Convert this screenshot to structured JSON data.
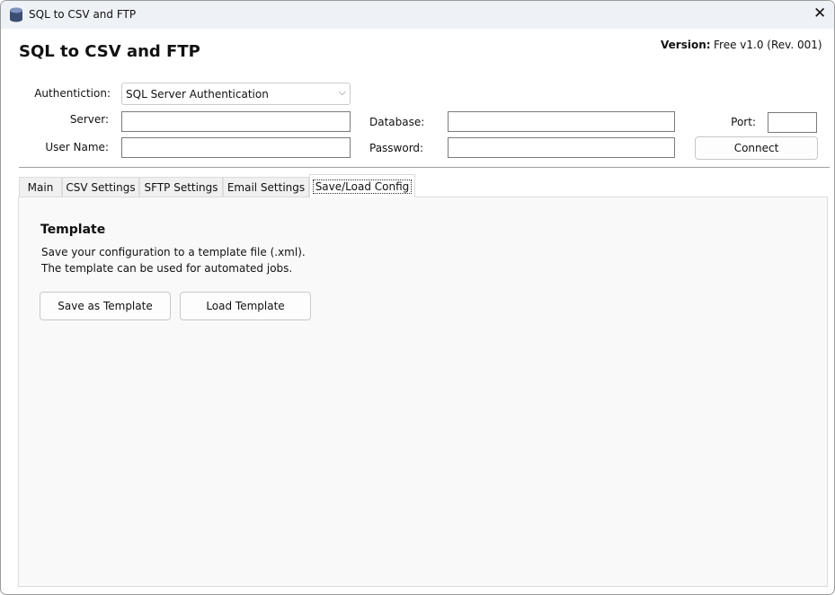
{
  "window": {
    "title": "SQL to CSV and FTP"
  },
  "header": {
    "title": "SQL to CSV and FTP",
    "version_label": "Version:",
    "version_value": "Free v1.0 (Rev. 001)"
  },
  "connection": {
    "auth_label": "Authentiction:",
    "auth_value": "SQL Server Authentication",
    "server_label": "Server:",
    "server_value": "",
    "database_label": "Database:",
    "database_value": "",
    "port_label": "Port:",
    "port_value": "",
    "username_label": "User Name:",
    "username_value": "",
    "password_label": "Password:",
    "password_value": "",
    "connect_label": "Connect"
  },
  "tabs": [
    {
      "label": "Main"
    },
    {
      "label": "CSV Settings"
    },
    {
      "label": "SFTP Settings"
    },
    {
      "label": "Email Settings"
    },
    {
      "label": "Save/Load Config",
      "selected": true
    }
  ],
  "template": {
    "heading": "Template",
    "line1": "Save your configuration to a template file (.xml).",
    "line2": "The template can be used for automated jobs.",
    "save_label": "Save as Template",
    "load_label": "Load Template"
  }
}
